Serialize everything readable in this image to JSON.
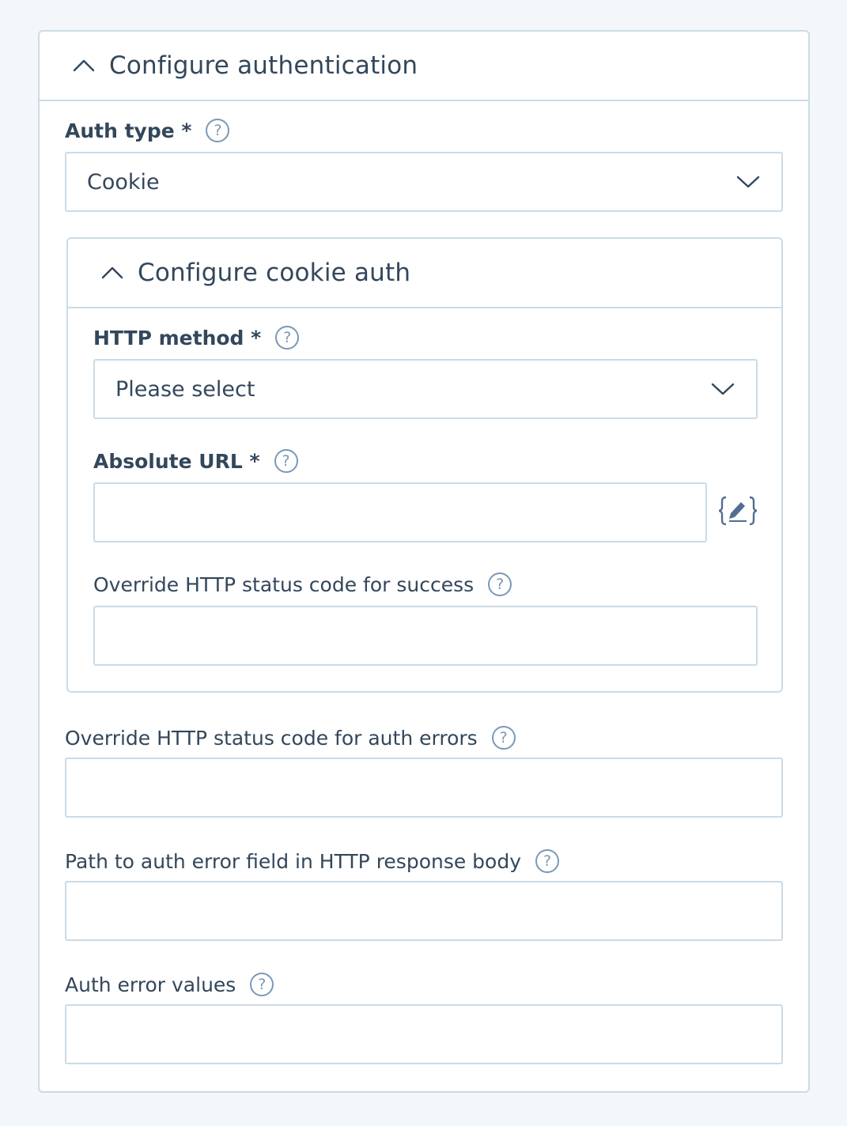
{
  "section": {
    "title": "Configure authentication"
  },
  "auth_type": {
    "label": "Auth type *",
    "value": "Cookie"
  },
  "cookie_auth": {
    "title": "Configure cookie auth",
    "http_method": {
      "label": "HTTP method *",
      "value": "Please select"
    },
    "absolute_url": {
      "label": "Absolute URL *",
      "value": ""
    },
    "success_code": {
      "label": "Override HTTP status code for success",
      "value": ""
    }
  },
  "auth_error_code": {
    "label": "Override HTTP status code for auth errors",
    "value": ""
  },
  "auth_error_path": {
    "label": "Path to auth error field in HTTP response body",
    "value": ""
  },
  "auth_error_values": {
    "label": "Auth error values",
    "value": ""
  },
  "help_glyph": "?",
  "icons": {
    "collapse": "chevron-up-icon",
    "dropdown": "chevron-down-icon",
    "help": "question-circle-icon",
    "variable": "curly-braces-pencil-icon"
  },
  "colors": {
    "border": "#cbdbe6",
    "text": "#33475b",
    "help": "#7c98b6",
    "background": "#f4f7fa"
  }
}
